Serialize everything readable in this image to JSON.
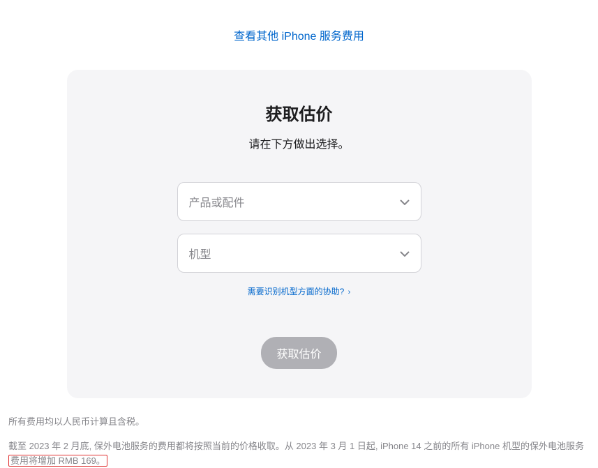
{
  "topLink": "查看其他 iPhone 服务费用",
  "card": {
    "title": "获取估价",
    "subtitle": "请在下方做出选择。",
    "select1": {
      "placeholder": "产品或配件"
    },
    "select2": {
      "placeholder": "机型"
    },
    "helpLink": "需要识别机型方面的协助?",
    "submitLabel": "获取估价"
  },
  "disclaimer": {
    "line1": "所有费用均以人民币计算且含税。",
    "line2_part1": "截至 2023 年 2 月底, 保外电池服务的费用都将按照当前的价格收取。从 2023 年 3 月 1 日起, iPhone 14 之前的所有 iPhone 机型的保外电池服务",
    "line2_highlight": "费用将增加 RMB 169。"
  }
}
